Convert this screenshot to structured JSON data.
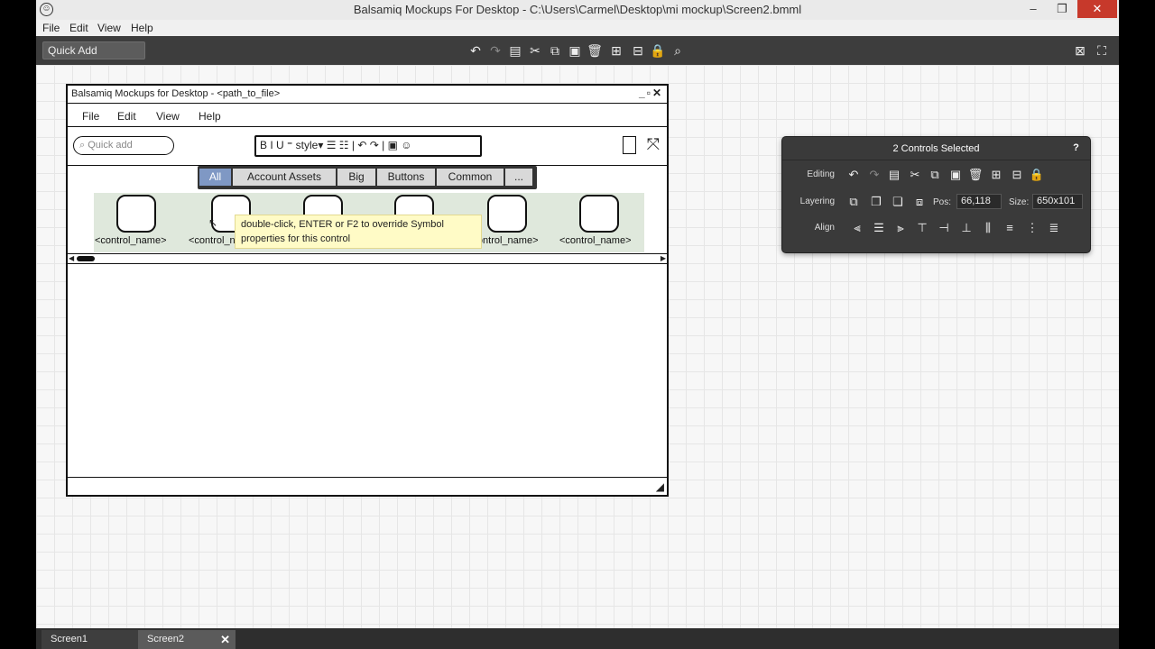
{
  "window": {
    "title": "Balsamiq Mockups For Desktop - C:\\Users\\Carmel\\Desktop\\mi mockup\\Screen2.bmml",
    "icons": [
      "app-smiley-icon",
      "minimize-icon",
      "restore-icon",
      "close-icon"
    ]
  },
  "menubar": [
    "File",
    "Edit",
    "View",
    "Help"
  ],
  "toolbar": {
    "quick_add_placeholder": "Quick Add",
    "icons": [
      "undo-icon",
      "redo-icon",
      "duplicate-icon",
      "cut-icon",
      "copy-icon",
      "paste-icon",
      "delete-icon",
      "group-icon",
      "ungroup-icon",
      "lock-icon",
      "search-icon",
      "close-view-icon",
      "fullscreen-icon"
    ]
  },
  "mockup": {
    "title": "Balsamiq Mockups for Desktop - <path_to_file>",
    "win_controls": "_▫✕",
    "menu": [
      "File",
      "Edit",
      "View",
      "Help"
    ],
    "search_placeholder": "Quick add",
    "rte": "B I U ⁼ style▾ ☰ ☷ | ↶ ↷ | ▣ ☺",
    "tabs": [
      "All",
      "Account Assets",
      "Big",
      "Buttons",
      "Common",
      "..."
    ],
    "symbol_label": "<control_name>",
    "tooltip": "double-click, ENTER or F2 to override Symbol properties for this control"
  },
  "inspector": {
    "title": "2 Controls Selected",
    "help": "?",
    "editing_label": "Editing",
    "layering_label": "Layering",
    "align_label": "Align",
    "pos_label": "Pos:",
    "pos_value": "66,118",
    "size_label": "Size:",
    "size_value": "650x101"
  },
  "screens": {
    "tab1": "Screen1",
    "tab2": "Screen2",
    "close": "✕"
  }
}
